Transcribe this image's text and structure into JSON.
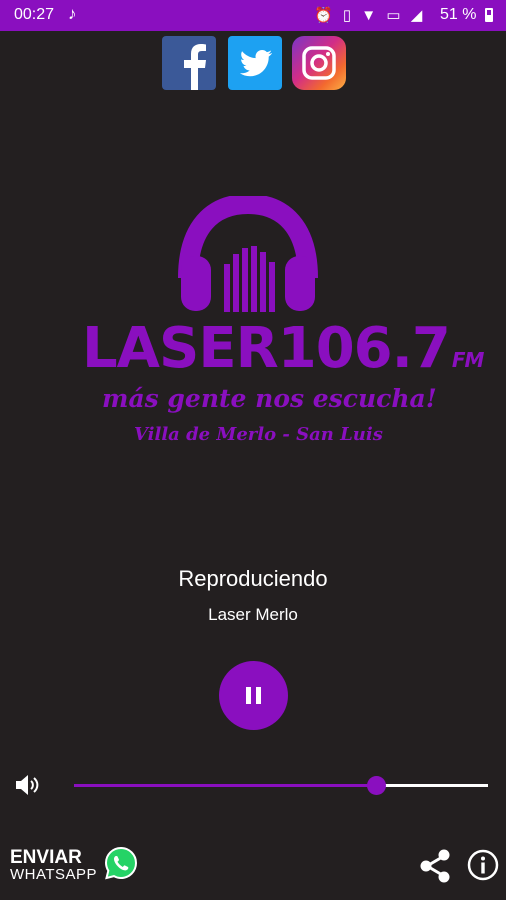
{
  "status_bar": {
    "time": "00:27",
    "music_icon": "music-note-icon",
    "icons": [
      "alarm-icon",
      "vibrate-icon",
      "wifi-icon",
      "no-sim-icon",
      "signal-icon"
    ],
    "battery_percent": "51 %"
  },
  "social": [
    {
      "name": "facebook",
      "icon": "facebook-icon",
      "color": "#3b5998"
    },
    {
      "name": "twitter",
      "icon": "twitter-icon",
      "color": "#1da1f2"
    },
    {
      "name": "instagram",
      "icon": "instagram-icon",
      "color": "#d22d86"
    }
  ],
  "logo": {
    "brand": "LASER106.7",
    "fm": "FM",
    "slogan": "más gente nos escucha!",
    "city": "Villa de Merlo - San Luis"
  },
  "player": {
    "status": "Reproduciendo",
    "station": "Laser Merlo",
    "state": "playing",
    "volume_level": 0.73
  },
  "bottom": {
    "whatsapp_line1": "ENVIAR",
    "whatsapp_line2": "WHATSAPP"
  },
  "colors": {
    "accent": "#8a0fbf",
    "background": "#231f20",
    "whatsapp": "#25d366"
  }
}
